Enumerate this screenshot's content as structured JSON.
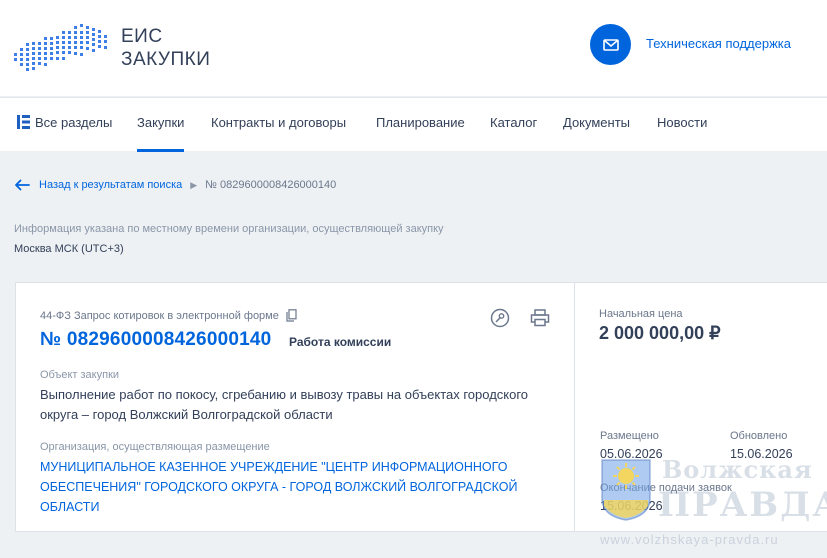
{
  "header": {
    "logo_line1": "ЕИС",
    "logo_line2": "ЗАКУПКИ",
    "support_label": "Техническая поддержка",
    "support_icon": "mail-icon"
  },
  "nav": {
    "items": [
      {
        "label": "Все разделы",
        "icon": "sections-icon"
      },
      {
        "label": "Закупки",
        "active": true
      },
      {
        "label": "Контракты и договоры"
      },
      {
        "label": "Планирование"
      },
      {
        "label": "Каталог"
      },
      {
        "label": "Документы"
      },
      {
        "label": "Новости"
      }
    ]
  },
  "breadcrumb": {
    "back_label": "Назад к результатам поиска",
    "current": "№ 0829600008426000140"
  },
  "timezone": {
    "note": "Информация указана по местному времени организации, осуществляющей закупку",
    "value": "Москва МСК (UTC+3)"
  },
  "purchase": {
    "law_type": "44-ФЗ Запрос котировок в электронной форме",
    "number": "№ 0829600008426000140",
    "stage": "Работа комиссии",
    "object_label": "Объект закупки",
    "object_text": "Выполнение работ по покосу, сгребанию и вывозу травы на объектах городского округа – город Волжский Волгоградской области",
    "org_label": "Организация, осуществляющая размещение",
    "org_name": "МУНИЦИПАЛЬНОЕ КАЗЕННОЕ УЧРЕЖДЕНИЕ \"ЦЕНТР ИНФОРМАЦИОННОГО ОБЕСПЕЧЕНИЯ\" ГОРОДСКОГО ОКРУГА - ГОРОД ВОЛЖСКИЙ ВОЛГОГРАДСКОЙ ОБЛАСТИ"
  },
  "summary": {
    "price_label": "Начальная цена",
    "price": "2 000 000,00 ₽",
    "placed_label": "Размещено",
    "placed": "05.06.2026",
    "updated_label": "Обновлено",
    "updated": "15.06.2026",
    "deadline_label": "Окончание подачи заявок",
    "deadline": "15.06.2026"
  },
  "watermark": {
    "line1": "Волжская",
    "line2": "ПРАВДА",
    "url": "www.volzhskaya-pravda.ru"
  },
  "colors": {
    "accent": "#0065dd",
    "text": "#334059",
    "muted": "#8a96a8",
    "background": "#eef1f4"
  }
}
